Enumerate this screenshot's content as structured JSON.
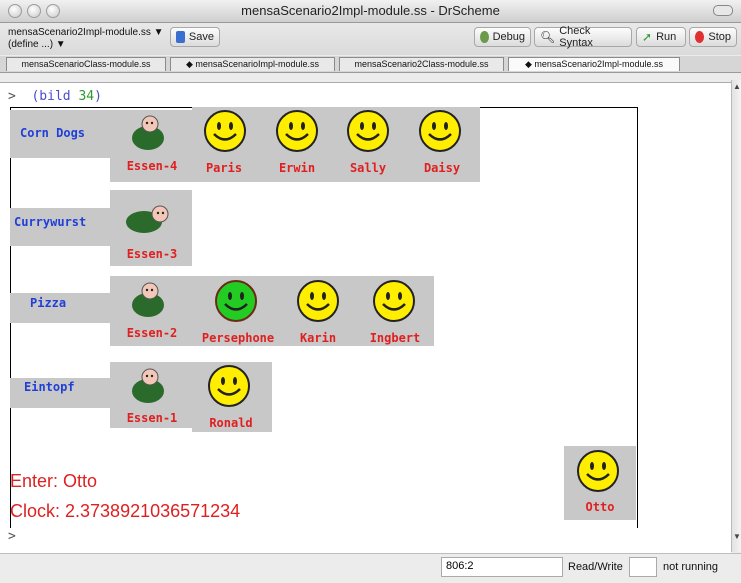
{
  "window": {
    "title": "mensaScenario2Impl-module.ss - DrScheme"
  },
  "toolbar": {
    "file_label": "mensaScenario2Impl-module.ss ▼",
    "define_label": "(define ...) ▼",
    "save": "Save",
    "debug": "Debug",
    "check_syntax": "Check Syntax",
    "run": "Run",
    "stop": "Stop"
  },
  "tabs": [
    "mensaScenarioClass-module.ss",
    "◆ mensaScenarioImpl-module.ss",
    "mensaScenario2Class-module.ss",
    "◆ mensaScenario2Impl-module.ss"
  ],
  "editor": {
    "prompt_symbol": ">",
    "call_open": "(bild",
    "call_arg": "34",
    "call_close": ")",
    "bottom_prompt": ">"
  },
  "scene": {
    "rows": [
      {
        "food": "Corn Dogs",
        "server": "Essen-4",
        "guests": [
          "Paris",
          "Erwin",
          "Sally",
          "Daisy"
        ]
      },
      {
        "food": "Currywurst",
        "server": "Essen-3",
        "guests": []
      },
      {
        "food": "Pizza",
        "server": "Essen-2",
        "guests": [
          "Persephone",
          "Karin",
          "Ingbert"
        ]
      },
      {
        "food": "Eintopf",
        "server": "Essen-1",
        "guests": [
          "Ronald"
        ]
      }
    ],
    "enter_text": "Enter: Otto",
    "clock_text": "Clock: 2.3738921036571234",
    "arriving": "Otto",
    "highlighted_guest": "Persephone"
  },
  "status": {
    "position": "806:2",
    "mode": "Read/Write",
    "running": "not running"
  },
  "colors": {
    "face_yellow": "#ffee00",
    "face_green": "#22cc22",
    "label_red": "#e02020",
    "food_blue": "#1f3fd8"
  }
}
